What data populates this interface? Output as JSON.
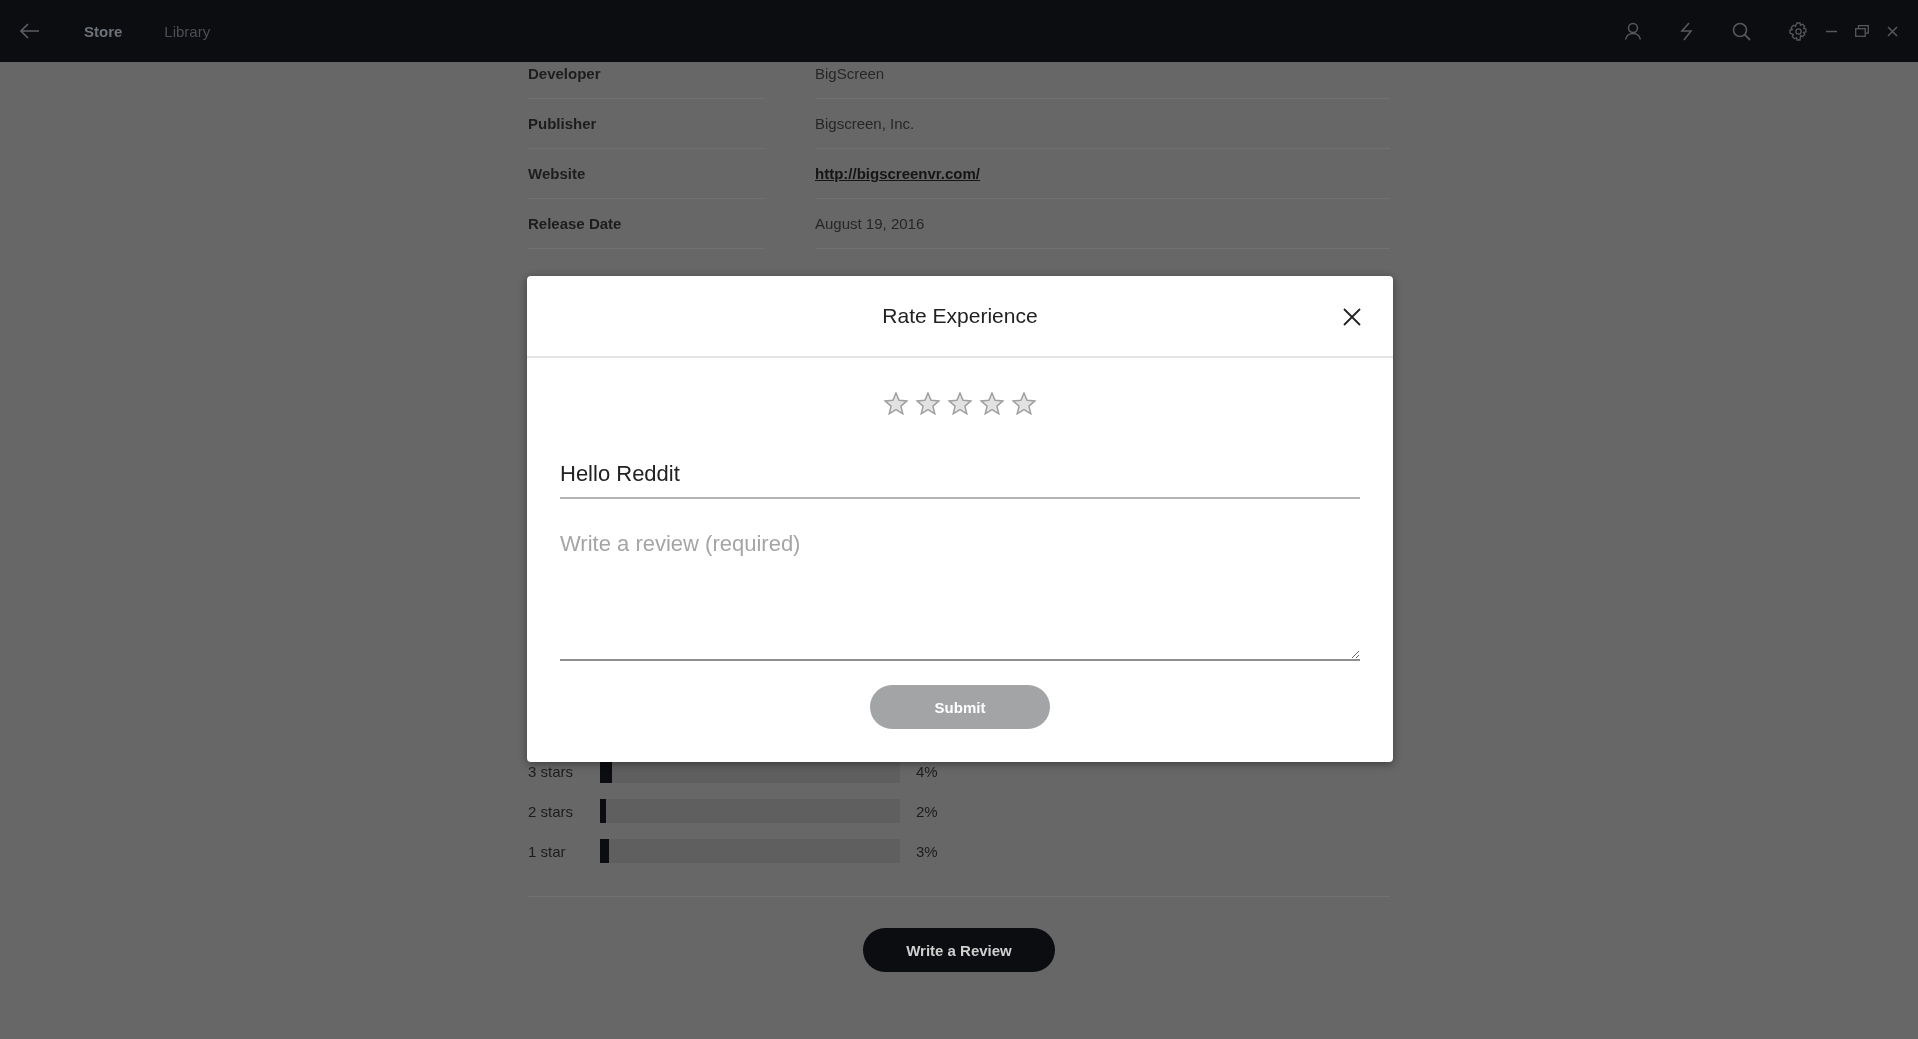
{
  "nav": {
    "tabs": [
      {
        "label": "Store",
        "selected": true
      },
      {
        "label": "Library",
        "selected": false
      }
    ]
  },
  "details": [
    {
      "label": "Developer",
      "value": "BigScreen",
      "kind": "text"
    },
    {
      "label": "Publisher",
      "value": "Bigscreen, Inc.",
      "kind": "text"
    },
    {
      "label": "Website",
      "value": "http://bigscreenvr.com/",
      "kind": "link"
    },
    {
      "label": "Release Date",
      "value": "August 19, 2016",
      "kind": "text"
    }
  ],
  "rating_breakdown": [
    {
      "label": "3 stars",
      "level": 0.04,
      "reading": "4%"
    },
    {
      "label": "2 stars",
      "level": 0.02,
      "reading": "2%"
    },
    {
      "label": "1 star",
      "level": 0.03,
      "reading": "3%"
    }
  ],
  "write_review_button": "Write a Review",
  "dialog": {
    "title": "Rate Experience",
    "stars": 0,
    "title_value": "Hello Reddit",
    "review_placeholder": "Write a review (required)",
    "submit": "Submit",
    "submit_disabled": true
  }
}
